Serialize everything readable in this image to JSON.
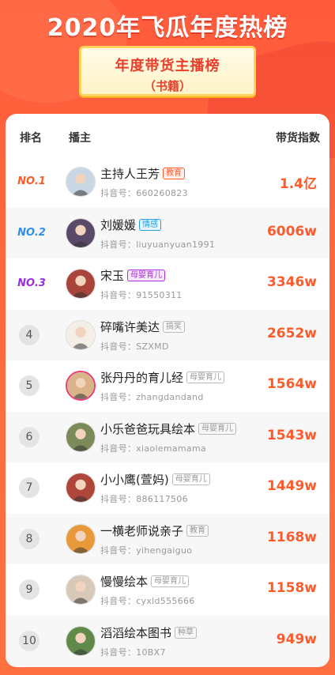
{
  "page_title": "2020年飞瓜年度热榜",
  "subtitle": "年度带货主播榜",
  "subtitle_tag": "（书籍）",
  "colors": {
    "accent": "#ff5a2a",
    "background": "#ff5a3c"
  },
  "table": {
    "headers": {
      "rank": "排名",
      "host": "播主",
      "index": "带货指数"
    },
    "id_prefix": "抖音号：",
    "rows": [
      {
        "rank": "NO.1",
        "rank_color": "#ff5a2a",
        "name": "主持人王芳",
        "tag": "教育",
        "tag_color": "#ff5a2a",
        "tag_bg": "#fff0ea",
        "id": "660260823",
        "index": "1.4亿",
        "avatar": "#c9d6e3"
      },
      {
        "rank": "NO.2",
        "rank_color": "#2f8fe6",
        "name": "刘媛媛",
        "tag": "情感",
        "tag_color": "#1e9fe0",
        "tag_bg": "#e6f5ff",
        "id": "liuyuanyuan1991",
        "index": "6006w",
        "avatar": "#5a4a6a"
      },
      {
        "rank": "NO.3",
        "rank_color": "#9a2fe0",
        "name": "宋玉",
        "tag": "母婴育儿",
        "tag_color": "#b02fd8",
        "tag_bg": "#f7e8ff",
        "id": "91550311",
        "index": "3346w",
        "avatar": "#a8443a"
      },
      {
        "rank": "4",
        "name": "碎嘴许美达",
        "tag": "搞笑",
        "id": "SZXMD",
        "index": "2652w",
        "avatar": "#f4efe6"
      },
      {
        "rank": "5",
        "name": "张丹丹的育儿经",
        "tag": "母婴育儿",
        "id": "zhangdandand",
        "index": "1564w",
        "avatar": "#d9b48a",
        "ring": true
      },
      {
        "rank": "6",
        "name": "小乐爸爸玩具绘本",
        "tag": "母婴育儿",
        "id": "xiaolemamama",
        "index": "1543w",
        "avatar": "#7c8a5a"
      },
      {
        "rank": "7",
        "name": "小小鹰(萱妈)",
        "tag": "母婴育儿",
        "id": "886117506",
        "index": "1449w",
        "avatar": "#b0463a"
      },
      {
        "rank": "8",
        "name": "一横老师说亲子",
        "tag": "教育",
        "id": "yihengaiguo",
        "index": "1168w",
        "avatar": "#e89a3a"
      },
      {
        "rank": "9",
        "name": "慢慢绘本",
        "tag": "母婴育儿",
        "id": "cyxld555666",
        "index": "1158w",
        "avatar": "#d8c8b8"
      },
      {
        "rank": "10",
        "name": "滔滔绘本图书",
        "tag": "种草",
        "id": "10BX7",
        "index": "949w",
        "avatar": "#5f8a4a"
      }
    ]
  }
}
